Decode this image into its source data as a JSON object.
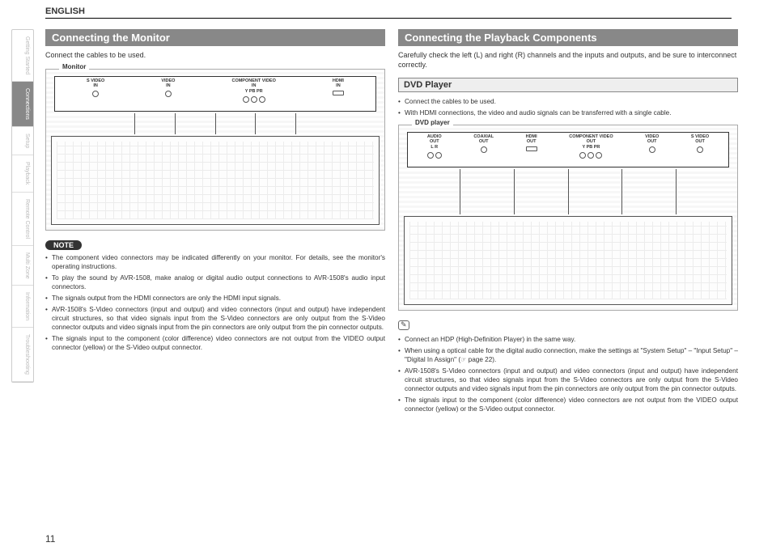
{
  "language": "ENGLISH",
  "page_number": "11",
  "sidebar": {
    "tabs": [
      {
        "label": "Getting Started",
        "active": false
      },
      {
        "label": "Connections",
        "active": true
      },
      {
        "label": "Setup",
        "active": false
      },
      {
        "label": "Playback",
        "active": false
      },
      {
        "label": "Remote Control",
        "active": false
      },
      {
        "label": "Multi Zone",
        "active": false
      },
      {
        "label": "Information",
        "active": false
      },
      {
        "label": "Troubleshooting",
        "active": false
      }
    ]
  },
  "left": {
    "title": "Connecting the Monitor",
    "intro": "Connect the cables to be used.",
    "diagram_label": "Monitor",
    "ports_caption": "VIDEO",
    "ports": [
      {
        "label": "S VIDEO",
        "sub": "IN",
        "type": "circle",
        "count": 1
      },
      {
        "label": "VIDEO",
        "sub": "IN",
        "type": "circle",
        "count": 1
      },
      {
        "label": "COMPONENT VIDEO",
        "sub": "IN",
        "cols": "Y  PB  PR",
        "type": "circle",
        "count": 3
      },
      {
        "label": "HDMI",
        "sub": "IN",
        "type": "rect",
        "count": 1
      }
    ],
    "note_badge": "NOTE",
    "notes": [
      "The component video connectors may be indicated differently on your monitor. For details, see the monitor's operating instructions.",
      "To play the sound by AVR-1508, make analog or digital audio output connections to AVR-1508's audio input connectors.",
      "The signals output from the HDMI connectors are only the HDMI input signals.",
      "AVR-1508's S-Video connectors (input and output) and video connectors (input and output) have independent circuit structures, so that video signals input from the S-Video connectors are only output from the S-Video connector outputs and video signals input from the pin connectors are only output from the pin connector outputs.",
      "The signals input to the component (color difference) video connectors are not output from the VIDEO output connector (yellow) or the S-Video output connector."
    ]
  },
  "right": {
    "title": "Connecting the Playback Components",
    "intro": "Carefully check the left (L) and right (R) channels and the inputs and outputs, and be sure to interconnect correctly.",
    "sub_title": "DVD Player",
    "sub_bullets": [
      "Connect the cables to be used.",
      "With HDMI connections, the video and audio signals can be transferred with a single cable."
    ],
    "diagram_label": "DVD player",
    "ports_caption_audio": "AUDIO",
    "ports_caption_video": "VIDEO",
    "ports": [
      {
        "label": "AUDIO",
        "sub": "OUT",
        "cols": "L  R",
        "type": "circle",
        "count": 2
      },
      {
        "label": "COAXIAL",
        "sub": "OUT",
        "type": "circle",
        "count": 1
      },
      {
        "label": "HDMI",
        "sub": "OUT",
        "type": "rect",
        "count": 1
      },
      {
        "label": "COMPONENT VIDEO",
        "sub": "OUT",
        "cols": "Y  PB  PR",
        "type": "circle",
        "count": 3
      },
      {
        "label": "VIDEO",
        "sub": "OUT",
        "type": "circle",
        "count": 1
      },
      {
        "label": "S VIDEO",
        "sub": "OUT",
        "type": "circle",
        "count": 1
      }
    ],
    "tip_ref": "page 22",
    "tips": [
      "Connect an HDP (High-Definition Player) in the same way.",
      "When using a optical cable for the digital audio connection, make the settings at \"System Setup\" – \"Input Setup\" – \"Digital In Assign\" (☞ page 22).",
      "AVR-1508's S-Video connectors (input and output) and video connectors (input and output) have independent circuit structures, so that video signals input from the S-Video connectors are only output from the S-Video connector outputs and video signals input from the pin connectors are only output from the pin connector outputs.",
      "The signals input to the component (color difference) video connectors are not output from the VIDEO output connector (yellow) or the S-Video output connector."
    ]
  }
}
